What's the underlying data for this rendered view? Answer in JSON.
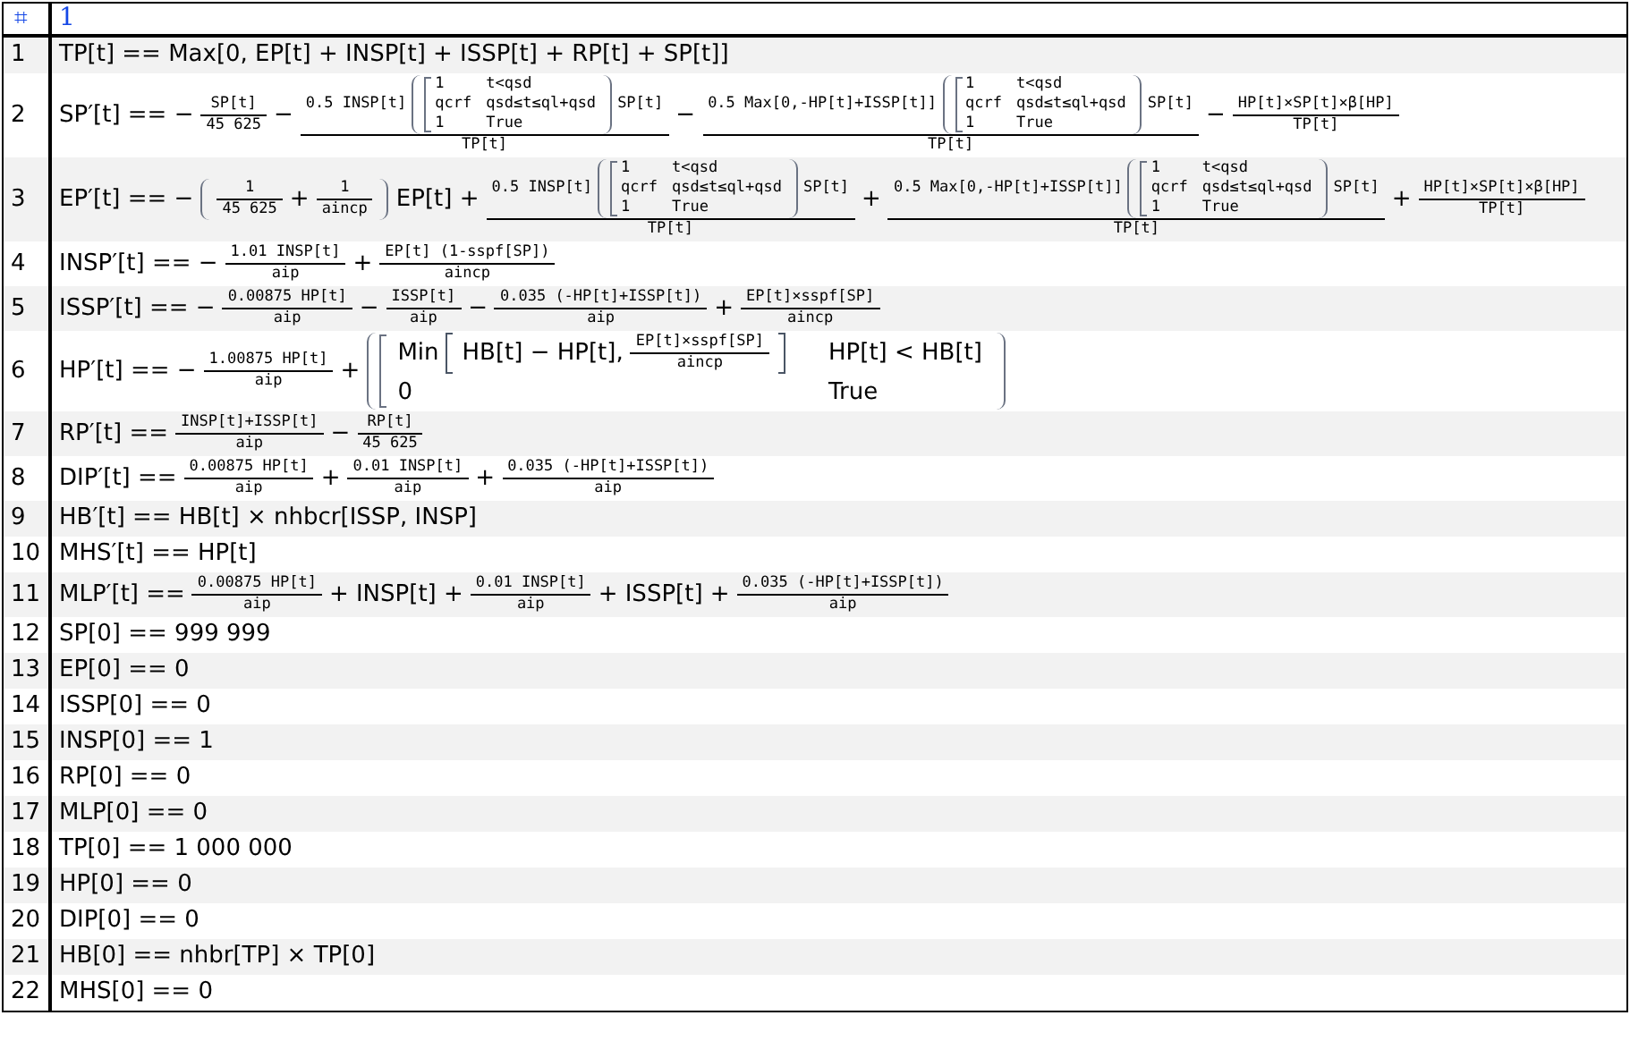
{
  "header": {
    "index_symbol": "⌗",
    "column": "1"
  },
  "rows": [
    {
      "number": "1",
      "content": [
        "TP[t] == Max[0, EP[t] + INSP[t] + ISSP[t] + RP[t] + SP[t]]"
      ]
    },
    {
      "number": "2",
      "content": [
        "SP′[t] == −",
        {
          "kind": "frac",
          "num": [
            "SP[t]"
          ],
          "den": [
            "45 625"
          ]
        },
        "−",
        {
          "kind": "frac",
          "num": [
            "0.5 INSP[t]",
            {
              "kind": "paren",
              "body": [
                {
                  "kind": "cases",
                  "rows": [
                    [
                      [
                        "1"
                      ],
                      [
                        "t<qsd"
                      ]
                    ],
                    [
                      [
                        "qcrf"
                      ],
                      [
                        "qsd≤t≤ql+qsd"
                      ]
                    ],
                    [
                      [
                        "1"
                      ],
                      [
                        "True"
                      ]
                    ]
                  ]
                }
              ]
            },
            "SP[t]"
          ],
          "den": [
            "TP[t]"
          ]
        },
        "−",
        {
          "kind": "frac",
          "num": [
            "0.5 Max[0,-HP[t]+ISSP[t]]",
            {
              "kind": "paren",
              "body": [
                {
                  "kind": "cases",
                  "rows": [
                    [
                      [
                        "1"
                      ],
                      [
                        "t<qsd"
                      ]
                    ],
                    [
                      [
                        "qcrf"
                      ],
                      [
                        "qsd≤t≤ql+qsd"
                      ]
                    ],
                    [
                      [
                        "1"
                      ],
                      [
                        "True"
                      ]
                    ]
                  ]
                }
              ]
            },
            "SP[t]"
          ],
          "den": [
            "TP[t]"
          ]
        },
        "−",
        {
          "kind": "frac",
          "num": [
            "HP[t]×SP[t]×β[HP]"
          ],
          "den": [
            "TP[t]"
          ]
        }
      ]
    },
    {
      "number": "3",
      "content": [
        "EP′[t] == −",
        {
          "kind": "paren",
          "body": [
            {
              "kind": "frac",
              "num": [
                "1"
              ],
              "den": [
                "45 625"
              ]
            },
            "+",
            {
              "kind": "frac",
              "num": [
                "1"
              ],
              "den": [
                "aincp"
              ]
            }
          ]
        },
        "EP[t] +",
        {
          "kind": "frac",
          "num": [
            "0.5 INSP[t]",
            {
              "kind": "paren",
              "body": [
                {
                  "kind": "cases",
                  "rows": [
                    [
                      [
                        "1"
                      ],
                      [
                        "t<qsd"
                      ]
                    ],
                    [
                      [
                        "qcrf"
                      ],
                      [
                        "qsd≤t≤ql+qsd"
                      ]
                    ],
                    [
                      [
                        "1"
                      ],
                      [
                        "True"
                      ]
                    ]
                  ]
                }
              ]
            },
            "SP[t]"
          ],
          "den": [
            "TP[t]"
          ]
        },
        "+",
        {
          "kind": "frac",
          "num": [
            "0.5 Max[0,-HP[t]+ISSP[t]]",
            {
              "kind": "paren",
              "body": [
                {
                  "kind": "cases",
                  "rows": [
                    [
                      [
                        "1"
                      ],
                      [
                        "t<qsd"
                      ]
                    ],
                    [
                      [
                        "qcrf"
                      ],
                      [
                        "qsd≤t≤ql+qsd"
                      ]
                    ],
                    [
                      [
                        "1"
                      ],
                      [
                        "True"
                      ]
                    ]
                  ]
                }
              ]
            },
            "SP[t]"
          ],
          "den": [
            "TP[t]"
          ]
        },
        "+",
        {
          "kind": "frac",
          "num": [
            "HP[t]×SP[t]×β[HP]"
          ],
          "den": [
            "TP[t]"
          ]
        }
      ]
    },
    {
      "number": "4",
      "content": [
        "INSP′[t] == −",
        {
          "kind": "frac",
          "num": [
            "1.01 INSP[t]"
          ],
          "den": [
            "aip"
          ]
        },
        "+",
        {
          "kind": "frac",
          "num": [
            "EP[t] (1-sspf[SP])"
          ],
          "den": [
            "aincp"
          ]
        }
      ]
    },
    {
      "number": "5",
      "content": [
        "ISSP′[t] == −",
        {
          "kind": "frac",
          "num": [
            "0.00875 HP[t]"
          ],
          "den": [
            "aip"
          ]
        },
        "−",
        {
          "kind": "frac",
          "num": [
            "ISSP[t]"
          ],
          "den": [
            "aip"
          ]
        },
        "−",
        {
          "kind": "frac",
          "num": [
            "0.035 (-HP[t]+ISSP[t])"
          ],
          "den": [
            "aip"
          ]
        },
        "+",
        {
          "kind": "frac",
          "num": [
            "EP[t]×sspf[SP]"
          ],
          "den": [
            "aincp"
          ]
        }
      ]
    },
    {
      "number": "6",
      "content": [
        "HP′[t] == −",
        {
          "kind": "frac",
          "num": [
            "1.00875 HP[t]"
          ],
          "den": [
            "aip"
          ]
        },
        "+",
        {
          "kind": "paren",
          "body": [
            {
              "kind": "cases",
              "rows": [
                [
                  [
                    "Min",
                    {
                      "kind": "bracket",
                      "body": [
                        "HB[t] − HP[t],",
                        {
                          "kind": "frac",
                          "num": [
                            "EP[t]×sspf[SP]"
                          ],
                          "den": [
                            "aincp"
                          ]
                        }
                      ]
                    }
                  ],
                  [
                    "HP[t] < HB[t]"
                  ]
                ],
                [
                  [
                    "0"
                  ],
                  [
                    "True"
                  ]
                ]
              ]
            }
          ]
        }
      ]
    },
    {
      "number": "7",
      "content": [
        "RP′[t] ==",
        {
          "kind": "frac",
          "num": [
            "INSP[t]+ISSP[t]"
          ],
          "den": [
            "aip"
          ]
        },
        "−",
        {
          "kind": "frac",
          "num": [
            "RP[t]"
          ],
          "den": [
            "45 625"
          ]
        }
      ]
    },
    {
      "number": "8",
      "content": [
        "DIP′[t] ==",
        {
          "kind": "frac",
          "num": [
            "0.00875 HP[t]"
          ],
          "den": [
            "aip"
          ]
        },
        "+",
        {
          "kind": "frac",
          "num": [
            "0.01 INSP[t]"
          ],
          "den": [
            "aip"
          ]
        },
        "+",
        {
          "kind": "frac",
          "num": [
            "0.035 (-HP[t]+ISSP[t])"
          ],
          "den": [
            "aip"
          ]
        }
      ]
    },
    {
      "number": "9",
      "content": [
        "HB′[t] == HB[t] × nhbcr[ISSP, INSP]"
      ]
    },
    {
      "number": "10",
      "content": [
        "MHS′[t] == HP[t]"
      ]
    },
    {
      "number": "11",
      "content": [
        "MLP′[t] ==",
        {
          "kind": "frac",
          "num": [
            "0.00875 HP[t]"
          ],
          "den": [
            "aip"
          ]
        },
        "+ INSP[t] +",
        {
          "kind": "frac",
          "num": [
            "0.01 INSP[t]"
          ],
          "den": [
            "aip"
          ]
        },
        "+ ISSP[t] +",
        {
          "kind": "frac",
          "num": [
            "0.035 (-HP[t]+ISSP[t])"
          ],
          "den": [
            "aip"
          ]
        }
      ]
    },
    {
      "number": "12",
      "content": [
        "SP[0] == 999 999"
      ]
    },
    {
      "number": "13",
      "content": [
        "EP[0] == 0"
      ]
    },
    {
      "number": "14",
      "content": [
        "ISSP[0] == 0"
      ]
    },
    {
      "number": "15",
      "content": [
        "INSP[0] == 1"
      ]
    },
    {
      "number": "16",
      "content": [
        "RP[0] == 0"
      ]
    },
    {
      "number": "17",
      "content": [
        "MLP[0] == 0"
      ]
    },
    {
      "number": "18",
      "content": [
        "TP[0] == 1 000 000"
      ]
    },
    {
      "number": "19",
      "content": [
        "HP[0] == 0"
      ]
    },
    {
      "number": "20",
      "content": [
        "DIP[0] == 0"
      ]
    },
    {
      "number": "21",
      "content": [
        "HB[0] == nhbr[TP] × TP[0]"
      ]
    },
    {
      "number": "22",
      "content": [
        "MHS[0] == 0"
      ]
    }
  ]
}
